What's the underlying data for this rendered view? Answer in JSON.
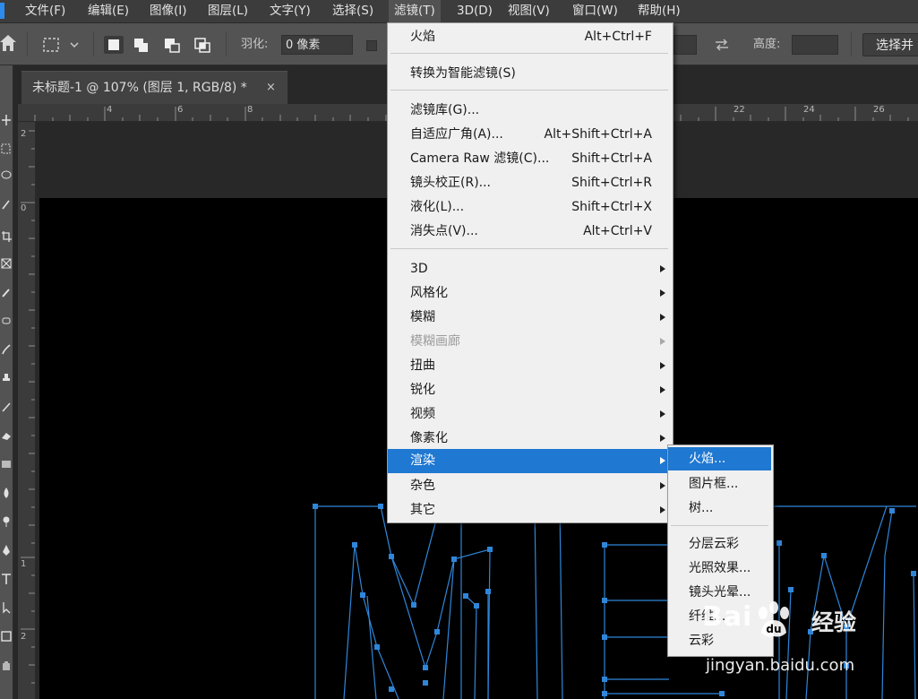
{
  "menubar": {
    "items": [
      {
        "label": "文件(F)"
      },
      {
        "label": "编辑(E)"
      },
      {
        "label": "图像(I)"
      },
      {
        "label": "图层(L)"
      },
      {
        "label": "文字(Y)"
      },
      {
        "label": "选择(S)"
      },
      {
        "label": "滤镜(T)"
      },
      {
        "label": "3D(D)"
      },
      {
        "label": "视图(V)"
      },
      {
        "label": "窗口(W)"
      },
      {
        "label": "帮助(H)"
      }
    ],
    "active_item": "滤镜(T)"
  },
  "options_bar": {
    "feather_label": "羽化:",
    "feather_value": "0 像素",
    "height_label": "高度:",
    "height_value": "",
    "select_button_label": "选择并"
  },
  "document": {
    "tab_title": "未标题-1 @ 107% (图层 1, RGB/8) *",
    "close_glyph": "×"
  },
  "rulers": {
    "horizontal_ticks": [
      "4",
      "6",
      "8",
      "22",
      "24",
      "26"
    ],
    "vertical_ticks": [
      "2",
      "0",
      "1",
      "2"
    ]
  },
  "filter_menu": {
    "items": [
      {
        "label": "火焰",
        "shortcut": "Alt+Ctrl+F"
      },
      {
        "separator": true
      },
      {
        "label": "转换为智能滤镜(S)",
        "shortcut": ""
      },
      {
        "separator": true
      },
      {
        "label": "滤镜库(G)...",
        "shortcut": ""
      },
      {
        "label": "自适应广角(A)...",
        "shortcut": "Alt+Shift+Ctrl+A"
      },
      {
        "label": "Camera Raw 滤镜(C)...",
        "shortcut": "Shift+Ctrl+A"
      },
      {
        "label": "镜头校正(R)...",
        "shortcut": "Shift+Ctrl+R"
      },
      {
        "label": "液化(L)...",
        "shortcut": "Shift+Ctrl+X"
      },
      {
        "label": "消失点(V)...",
        "shortcut": "Alt+Ctrl+V"
      },
      {
        "separator": true
      },
      {
        "label": "3D",
        "submenu": true
      },
      {
        "label": "风格化",
        "submenu": true
      },
      {
        "label": "模糊",
        "submenu": true
      },
      {
        "label": "模糊画廊",
        "submenu": true,
        "disabled": true
      },
      {
        "label": "扭曲",
        "submenu": true
      },
      {
        "label": "锐化",
        "submenu": true
      },
      {
        "label": "视频",
        "submenu": true
      },
      {
        "label": "像素化",
        "submenu": true
      },
      {
        "label": "渲染",
        "submenu": true,
        "highlighted": true
      },
      {
        "label": "杂色",
        "submenu": true
      },
      {
        "label": "其它",
        "submenu": true
      }
    ]
  },
  "render_submenu": {
    "items": [
      {
        "label": "火焰...",
        "highlighted": true
      },
      {
        "label": "图片框..."
      },
      {
        "label": "树..."
      },
      {
        "separator": true
      },
      {
        "label": "分层云彩"
      },
      {
        "label": "光照效果..."
      },
      {
        "label": "镜头光晕..."
      },
      {
        "label": "纤维..."
      },
      {
        "label": "云彩"
      }
    ]
  },
  "watermark": {
    "brand": "Bai",
    "product": "经验",
    "url": "jingyan.baidu.com"
  },
  "colors": {
    "menu_highlight": "#1f78d1",
    "path_stroke": "#2f86d9",
    "canvas": "#000000",
    "workspace": "#282828"
  }
}
